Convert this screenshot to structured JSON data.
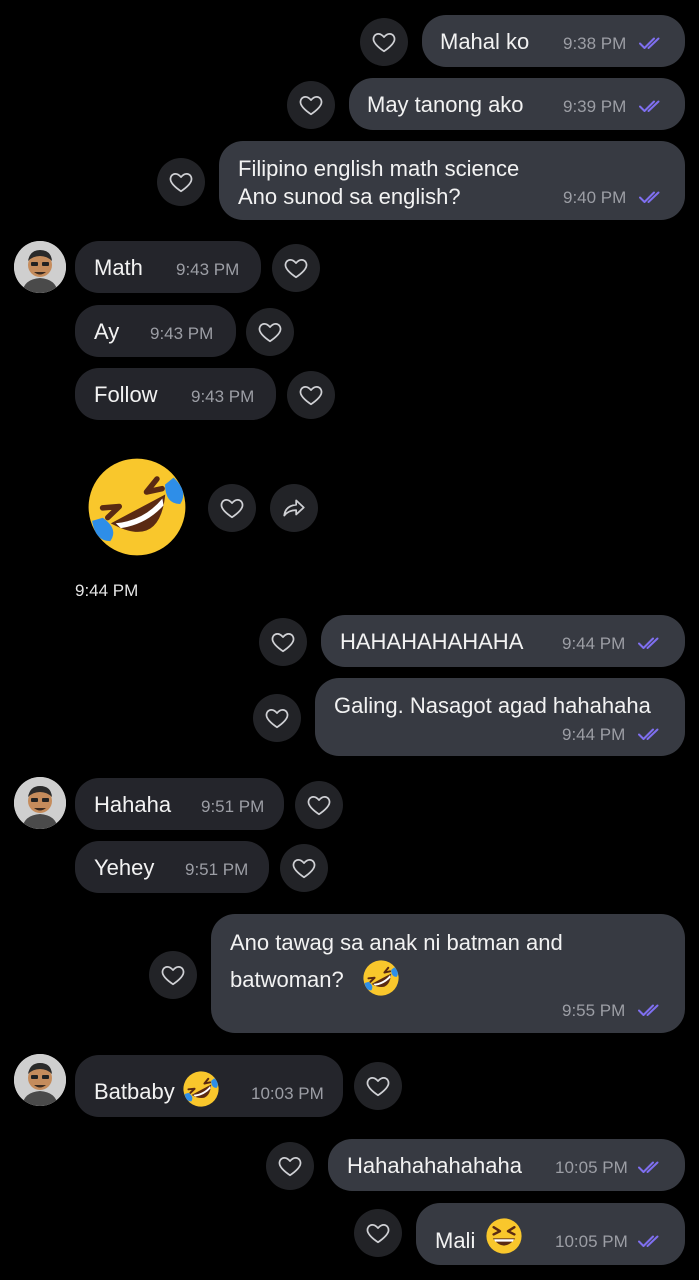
{
  "messages": [
    {
      "text": "Mahal ko",
      "time": "9:38 PM"
    },
    {
      "text": "May tanong ako",
      "time": "9:39 PM"
    },
    {
      "line1": "Filipino english math science",
      "line2": "Ano sunod sa english?",
      "time": "9:40 PM"
    },
    {
      "text": "Math",
      "time": "9:43 PM"
    },
    {
      "text": "Ay",
      "time": "9:43 PM"
    },
    {
      "text": "Follow",
      "time": "9:43 PM"
    },
    {
      "time": "9:44 PM",
      "emoji": "rolling-on-floor-laughing"
    },
    {
      "text": "HAHAHAHAHAHA",
      "time": "9:44 PM"
    },
    {
      "text": "Galing. Nasagot agad hahahaha",
      "time": "9:44 PM"
    },
    {
      "text": "Hahaha",
      "time": "9:51 PM"
    },
    {
      "text": "Yehey",
      "time": "9:51 PM"
    },
    {
      "line1": "Ano tawag sa anak ni batman and",
      "line2": "batwoman?",
      "time": "9:55 PM"
    },
    {
      "text": "Batbaby",
      "time": "10:03 PM"
    },
    {
      "text": "Hahahahahahaha",
      "time": "10:05 PM"
    },
    {
      "text": "Mali",
      "time": "10:05 PM"
    }
  ],
  "colors": {
    "sent_bubble": "#373a42",
    "received_bubble": "#24252b",
    "read_ticks": "#7f6ff0",
    "background": "#000000"
  }
}
